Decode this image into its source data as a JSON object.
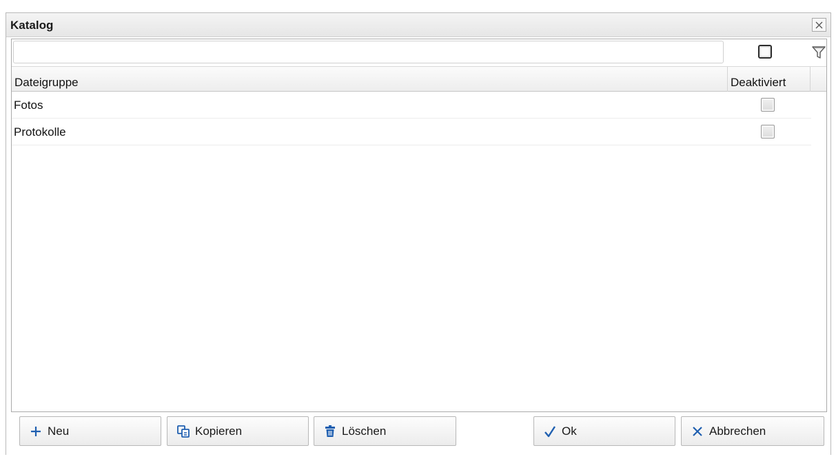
{
  "window": {
    "title": "Katalog"
  },
  "filter": {
    "value": "",
    "checked": false
  },
  "table": {
    "columns": [
      "Dateigruppe",
      "Deaktiviert"
    ],
    "rows": [
      {
        "name": "Fotos",
        "deaktiviert": false
      },
      {
        "name": "Protokolle",
        "deaktiviert": false
      }
    ]
  },
  "buttons": {
    "neu": "Neu",
    "kopieren": "Kopieren",
    "loeschen": "Löschen",
    "ok": "Ok",
    "abbrechen": "Abbrechen"
  },
  "colors": {
    "icon_blue": "#1f5fb0",
    "text": "#111111"
  }
}
